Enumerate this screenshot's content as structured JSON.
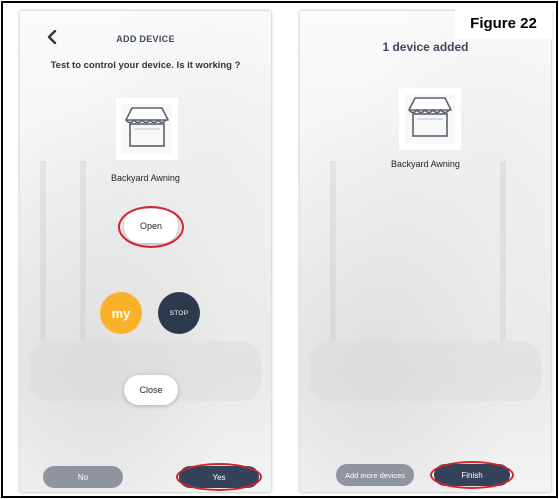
{
  "figure_label": "Figure 22",
  "left_screen": {
    "header_title": "ADD DEVICE",
    "back_icon": "chevron-left-icon",
    "question": "Test to control your device. Is it working ?",
    "device_icon": "awning-icon",
    "device_name": "Backyard Awning",
    "open_label": "Open",
    "my_label": "my",
    "stop_label": "STOP",
    "close_label": "Close",
    "no_label": "No",
    "yes_label": "Yes"
  },
  "right_screen": {
    "title": "1 device added",
    "device_icon": "awning-icon",
    "device_name": "Backyard Awning",
    "add_more_label": "Add more devices",
    "finish_label": "Finish"
  },
  "colors": {
    "my_button": "#f7b22a",
    "stop_button": "#2d394d",
    "primary_button": "#34425a",
    "secondary_button": "#8f959c",
    "highlight_ring": "#d0262c"
  }
}
